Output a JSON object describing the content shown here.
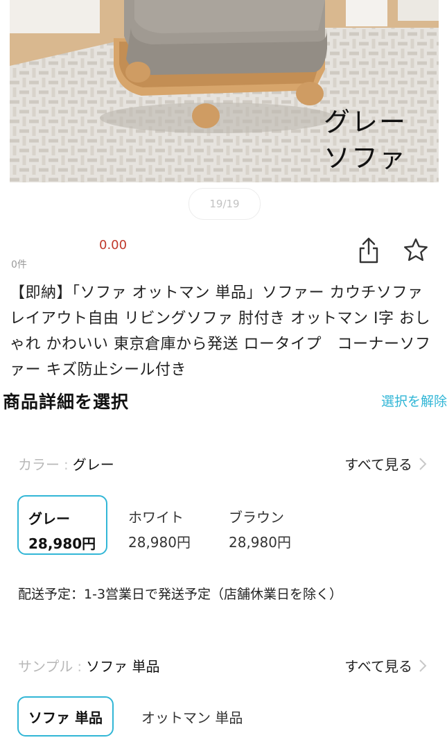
{
  "gallery": {
    "caption_line1": "グレー",
    "caption_line2": "ソファ",
    "counter": "19/19"
  },
  "product": {
    "price": "0.00",
    "review_count": "0件",
    "title": "【即納】「ソファ オットマン 単品」ソファー カウチソファ レイアウト自由 リビングソファ 肘付き オットマン I字 おしゃれ かわいい 東京倉庫から発送 ロータイプ　コーナーソファー キズ防止シール付き"
  },
  "details": {
    "heading": "商品詳細を選択",
    "clear_label": "選択を解除"
  },
  "color_option": {
    "key": "カラー",
    "separator": ":",
    "selected_value": "グレー",
    "see_all": "すべて見る",
    "variants": [
      {
        "name": "グレー",
        "price": "28,980円",
        "selected": true
      },
      {
        "name": "ホワイト",
        "price": "28,980円",
        "selected": false
      },
      {
        "name": "ブラウン",
        "price": "28,980円",
        "selected": false
      }
    ],
    "shipping": "配送予定：1-3営業日で発送予定（店舗休業日を除く）"
  },
  "sample_option": {
    "key": "サンプル",
    "separator": ":",
    "selected_value": "ソファ 単品",
    "see_all": "すべて見る",
    "choices": [
      {
        "label": "ソファ 単品",
        "selected": true
      },
      {
        "label": "オットマン 単品",
        "selected": false
      }
    ]
  },
  "colors": {
    "accent": "#31b6d6",
    "price": "#c0392b",
    "sofa_fabric": "#a09a92",
    "wood": "#d7a56b"
  },
  "icons": [
    "share-icon",
    "star-icon",
    "chevron-right-icon"
  ]
}
